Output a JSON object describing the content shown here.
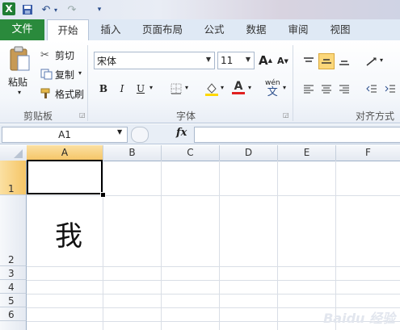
{
  "quick_access": {
    "undo_label": "↶",
    "redo_label": "↷",
    "customize_label": "▾"
  },
  "tabs": [
    {
      "label": "文件"
    },
    {
      "label": "开始"
    },
    {
      "label": "插入"
    },
    {
      "label": "页面布局"
    },
    {
      "label": "公式"
    },
    {
      "label": "数据"
    },
    {
      "label": "审阅"
    },
    {
      "label": "视图"
    }
  ],
  "clipboard": {
    "paste": "粘贴",
    "cut": "剪切",
    "copy": "复制",
    "format_painter": "格式刷",
    "group_label": "剪贴板"
  },
  "font": {
    "name": "宋体",
    "size": "11",
    "grow": "A",
    "shrink": "A",
    "bold": "B",
    "italic": "I",
    "underline": "U",
    "font_color_glyph": "A",
    "wen_glyph": "wén",
    "wen_char": "文",
    "group_label": "字体"
  },
  "alignment": {
    "group_label": "对齐方式"
  },
  "formula_bar": {
    "name_box": "A1",
    "fx": "fx",
    "content": ""
  },
  "columns": [
    "A",
    "B",
    "C",
    "D",
    "E",
    "F"
  ],
  "rows": [
    "1",
    "2",
    "3",
    "4",
    "5",
    "6"
  ],
  "cells": {
    "A2": "我"
  },
  "colors": {
    "file_tab": "#2a8a3c",
    "selection_header": "#f5c565",
    "fill_yellow": "#ffd800",
    "font_red": "#e02020"
  },
  "watermark": "Baidu 经验"
}
